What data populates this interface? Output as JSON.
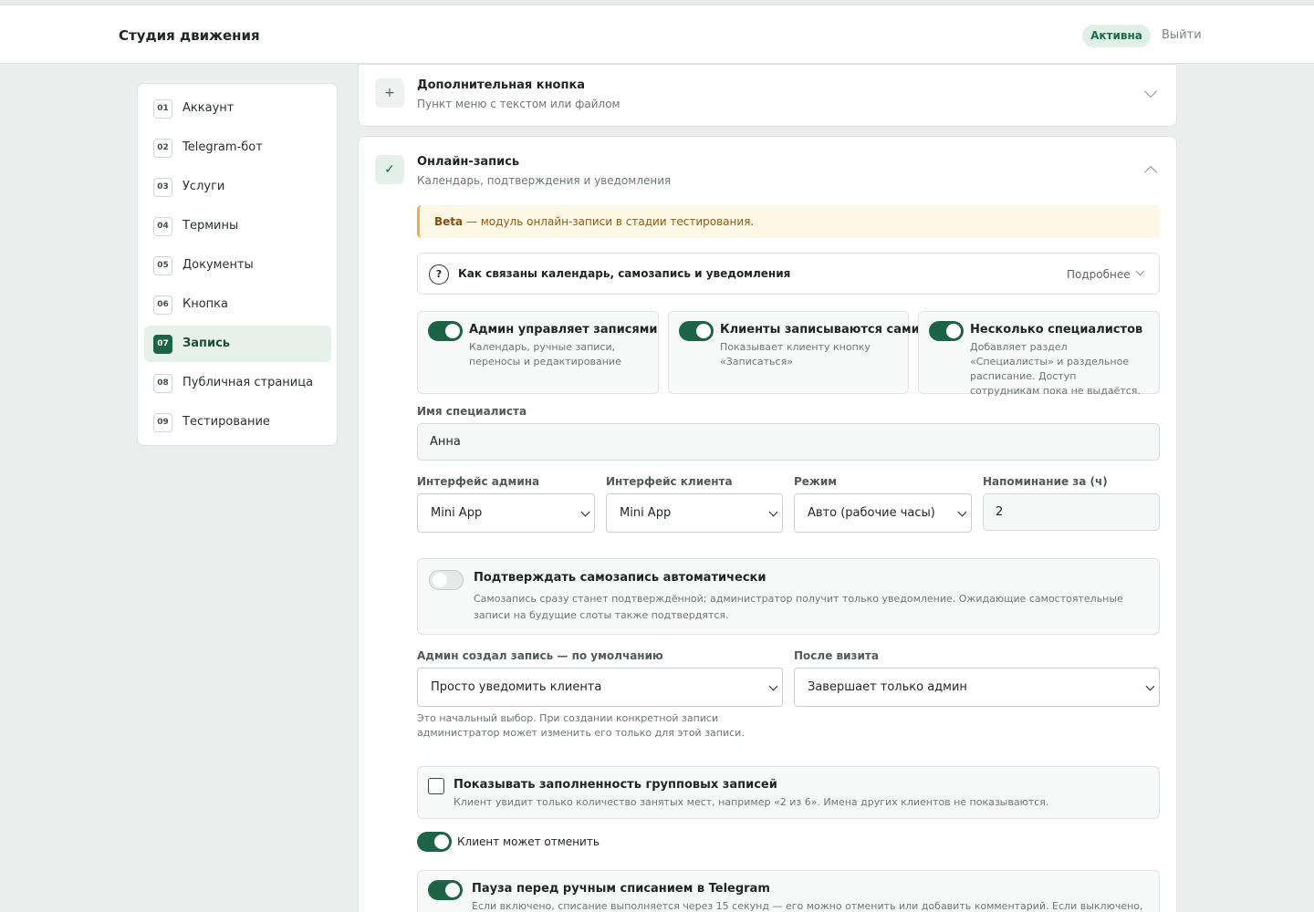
{
  "header": {
    "brand": "Студия движения",
    "status": "Активна",
    "logout": "Выйти"
  },
  "sidebar": {
    "items": [
      {
        "num": "01",
        "label": "Аккаунт"
      },
      {
        "num": "02",
        "label": "Telegram-бот"
      },
      {
        "num": "03",
        "label": "Услуги"
      },
      {
        "num": "04",
        "label": "Термины"
      },
      {
        "num": "05",
        "label": "Документы"
      },
      {
        "num": "06",
        "label": "Кнопка"
      },
      {
        "num": "07",
        "label": "Запись",
        "active": true
      },
      {
        "num": "08",
        "label": "Публичная страница"
      },
      {
        "num": "09",
        "label": "Тестирование"
      }
    ]
  },
  "extra_button": {
    "icon": "+",
    "title": "Дополнительная кнопка",
    "subtitle": "Пункт меню с текстом или файлом"
  },
  "booking": {
    "icon": "✓",
    "title": "Онлайн-запись",
    "subtitle": "Календарь, подтверждения и уведомления",
    "beta_tag": "Beta",
    "beta_text": " — модуль онлайн-записи в стадии тестирования.",
    "info": {
      "icon": "?",
      "title": "Как связаны календарь, самозапись и уведомления",
      "more": "Подробнее"
    },
    "options": [
      {
        "title": "Админ управляет записями",
        "desc": "Календарь, ручные записи, переносы и редактирование",
        "enabled": true
      },
      {
        "title": "Клиенты записываются сами",
        "desc": "Показывает клиенту кнопку «Записаться»",
        "enabled": true
      },
      {
        "title": "Несколько специалистов",
        "desc": "Добавляет раздел «Специалисты» и раздельное расписание. Доступ сотрудникам пока не выдаётся.",
        "enabled": true
      }
    ],
    "specialist": {
      "label": "Имя специалиста",
      "value": "Анна"
    },
    "admin_ui": {
      "label": "Интерфейс админа",
      "value": "Mini App"
    },
    "client_ui": {
      "label": "Интерфейс клиента",
      "value": "Mini App"
    },
    "mode": {
      "label": "Режим",
      "value": "Авто (рабочие часы)"
    },
    "reminder": {
      "label": "Напоминание за (ч)",
      "value": "2"
    },
    "auto_confirm": {
      "title": "Подтверждать самозапись автоматически",
      "desc": "Самозапись сразу станет подтверждённой; администратор получит только уведомление. Ожидающие самостоятельные записи на будущие слоты также подтвердятся.",
      "enabled": false
    },
    "admin_default": {
      "label": "Админ создал запись — по умолчанию",
      "value": "Просто уведомить клиента"
    },
    "after_visit": {
      "label": "После визита",
      "value": "Завершает только админ"
    },
    "hint": "Это начальный выбор. При создании конкретной записи администратор может изменить его только для этой записи.",
    "group_fill": {
      "title": "Показывать заполненность групповых записей",
      "desc": "Клиент увидит только количество занятых мест, например «2 из 6». Имена других клиентов не показываются.",
      "checked": false
    },
    "client_cancel": {
      "label": "Клиент может отменить",
      "enabled": true
    },
    "pause": {
      "title": "Пауза перед ручным списанием в Telegram",
      "desc": "Если включено, списание выполняется через 15 секунд — его можно отменить или добавить комментарий. Если выключено, урок",
      "enabled": true
    }
  }
}
